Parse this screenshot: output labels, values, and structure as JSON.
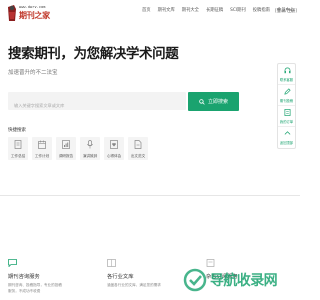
{
  "header": {
    "logo_small": "www.dwrv.com",
    "logo_main": "期刊之家",
    "nav": [
      {
        "label": "首页",
        "active": false
      },
      {
        "label": "期刊文库",
        "active": false
      },
      {
        "label": "期刊大全",
        "active": false
      },
      {
        "label": "长期征稿",
        "active": false
      },
      {
        "label": "SCI期刊",
        "active": false
      },
      {
        "label": "投稿指南",
        "active": false
      },
      {
        "label": "会员中心",
        "active": false
      }
    ],
    "login": "[登录/注册]"
  },
  "hero": {
    "title": "搜索期刊，为您解决学术问题",
    "subtitle": "加速晋升的不二法宝"
  },
  "search": {
    "placeholder": "输入关键字搜索文章或文库",
    "button_label": "立即搜索"
  },
  "quick": {
    "label": "快捷搜索",
    "items": [
      {
        "label": "工作总结",
        "icon": "document-icon"
      },
      {
        "label": "工作计划",
        "icon": "calendar-icon"
      },
      {
        "label": "调研报告",
        "icon": "report-icon"
      },
      {
        "label": "演讲致辞",
        "icon": "microphone-icon"
      },
      {
        "label": "心得体会",
        "icon": "heart-book-icon"
      },
      {
        "label": "出文范文",
        "icon": "file-icon"
      }
    ]
  },
  "cards": [
    {
      "title": "期刊咨询服务",
      "desc": "期刊咨询、投稿指导，专业的投稿",
      "desc2": "服务，不成功不收费",
      "icon": "chat-icon"
    },
    {
      "title": "各行业文库",
      "desc": "涵盖各行业的文库，满足您的需求",
      "desc2": "",
      "icon": "book-icon"
    },
    {
      "title": "杂志订阅服务",
      "desc": "",
      "desc2": "",
      "icon": "magazine-icon"
    }
  ],
  "float_bar": [
    {
      "label": "联系客服",
      "icon": "headset-icon"
    },
    {
      "label": "期刊投稿",
      "icon": "pen-icon"
    },
    {
      "label": "我的订单",
      "icon": "order-icon"
    },
    {
      "label": "返回顶部",
      "icon": "arrow-up-icon"
    }
  ],
  "watermark": "导航收录网",
  "colors": {
    "accent": "#1aa36f",
    "logo_red": "#c0392b"
  }
}
